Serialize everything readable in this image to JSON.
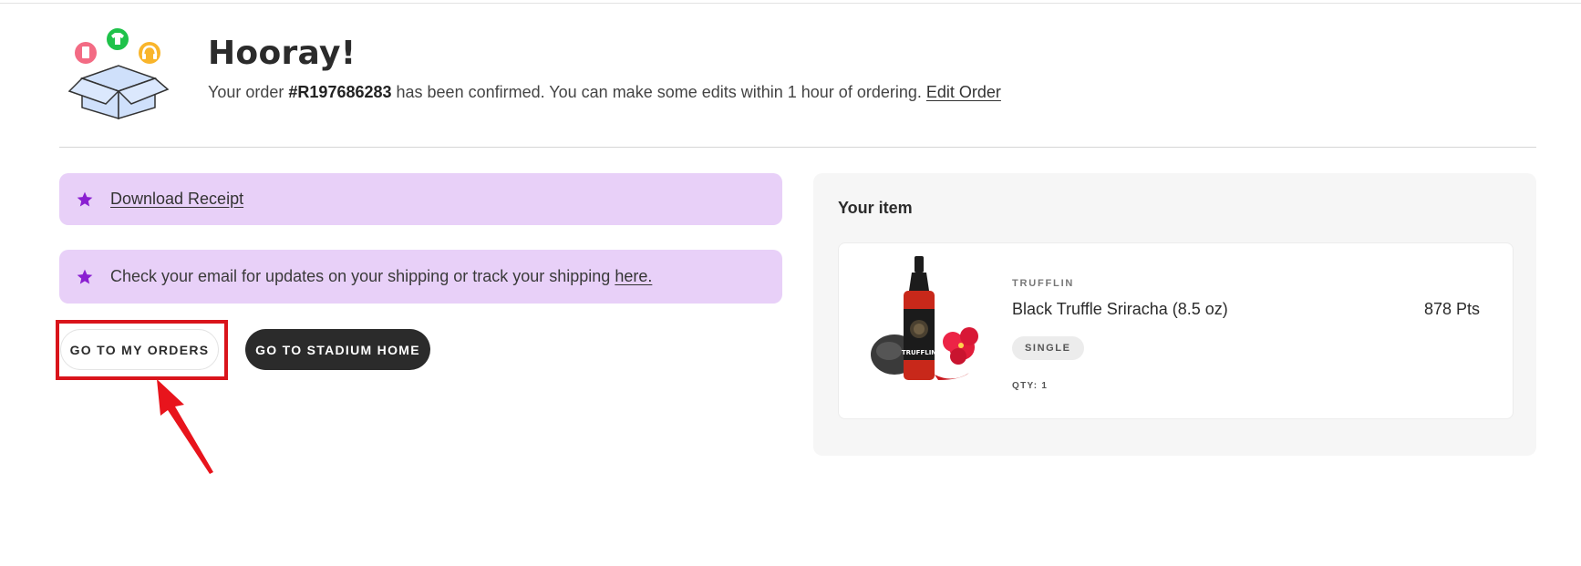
{
  "header": {
    "title": "Hooray!",
    "message_prefix": "Your order ",
    "order_number": "#R197686283",
    "message_suffix": " has been confirmed. You can make some edits within 1 hour of ordering. ",
    "edit_link": "Edit Order"
  },
  "banners": {
    "receipt_link": "Download Receipt",
    "email_text": "Check your email for updates on your shipping or track your shipping ",
    "email_link": "here."
  },
  "buttons": {
    "my_orders": "GO TO MY ORDERS",
    "stadium_home": "GO TO STADIUM HOME"
  },
  "item_panel": {
    "title": "Your item",
    "item": {
      "brand": "TRUFFLIN",
      "name": "Black Truffle Sriracha (8.5 oz)",
      "price": "878 Pts",
      "variant": "SINGLE",
      "qty": "QTY: 1",
      "bottle_label": "TRUFFLIN"
    }
  },
  "colors": {
    "banner_bg": "#e8d0f8",
    "star": "#8a1fd1",
    "dark_button": "#2b2b2b",
    "highlight": "#d9141b"
  },
  "icons": {
    "hero": "open-box-with-products-icon",
    "banner": "star-icon",
    "annotation": "red-arrow-annotation"
  }
}
